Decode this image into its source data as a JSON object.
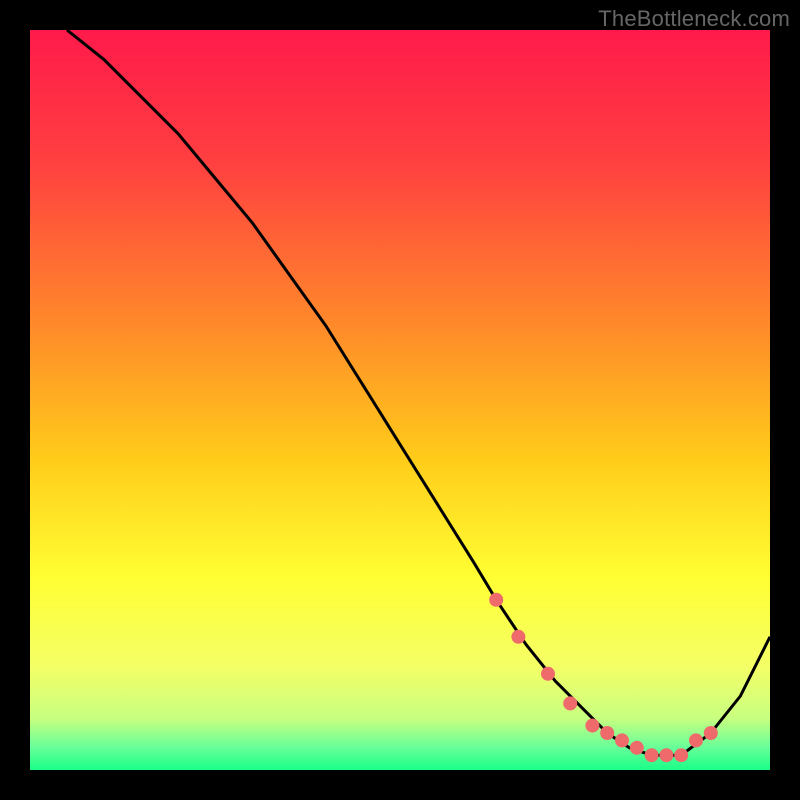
{
  "attribution": "TheBottleneck.com",
  "chart_data": {
    "type": "line",
    "title": "",
    "xlabel": "",
    "ylabel": "",
    "xlim": [
      0,
      100
    ],
    "ylim": [
      0,
      100
    ],
    "curve": {
      "name": "bottleneck-curve",
      "x": [
        5,
        10,
        15,
        20,
        25,
        30,
        35,
        40,
        45,
        50,
        55,
        60,
        63,
        67,
        71,
        75,
        78,
        81,
        84,
        88,
        92,
        96,
        100
      ],
      "y": [
        100,
        96,
        91,
        86,
        80,
        74,
        67,
        60,
        52,
        44,
        36,
        28,
        23,
        17,
        12,
        8,
        5,
        3,
        2,
        2,
        5,
        10,
        18
      ]
    },
    "markers": {
      "name": "optimum-points",
      "x": [
        63,
        66,
        70,
        73,
        76,
        78,
        80,
        82,
        84,
        86,
        88,
        90,
        92
      ],
      "y": [
        23,
        18,
        13,
        9,
        6,
        5,
        4,
        3,
        2,
        2,
        2,
        4,
        5
      ]
    },
    "gradient_stops": [
      {
        "offset": 0.0,
        "color": "#ff1a4b"
      },
      {
        "offset": 0.18,
        "color": "#ff4040"
      },
      {
        "offset": 0.4,
        "color": "#ff8a2a"
      },
      {
        "offset": 0.58,
        "color": "#ffcc1a"
      },
      {
        "offset": 0.74,
        "color": "#ffff33"
      },
      {
        "offset": 0.86,
        "color": "#f4ff66"
      },
      {
        "offset": 0.93,
        "color": "#c8ff80"
      },
      {
        "offset": 0.97,
        "color": "#66ff99"
      },
      {
        "offset": 1.0,
        "color": "#1aff88"
      }
    ]
  }
}
